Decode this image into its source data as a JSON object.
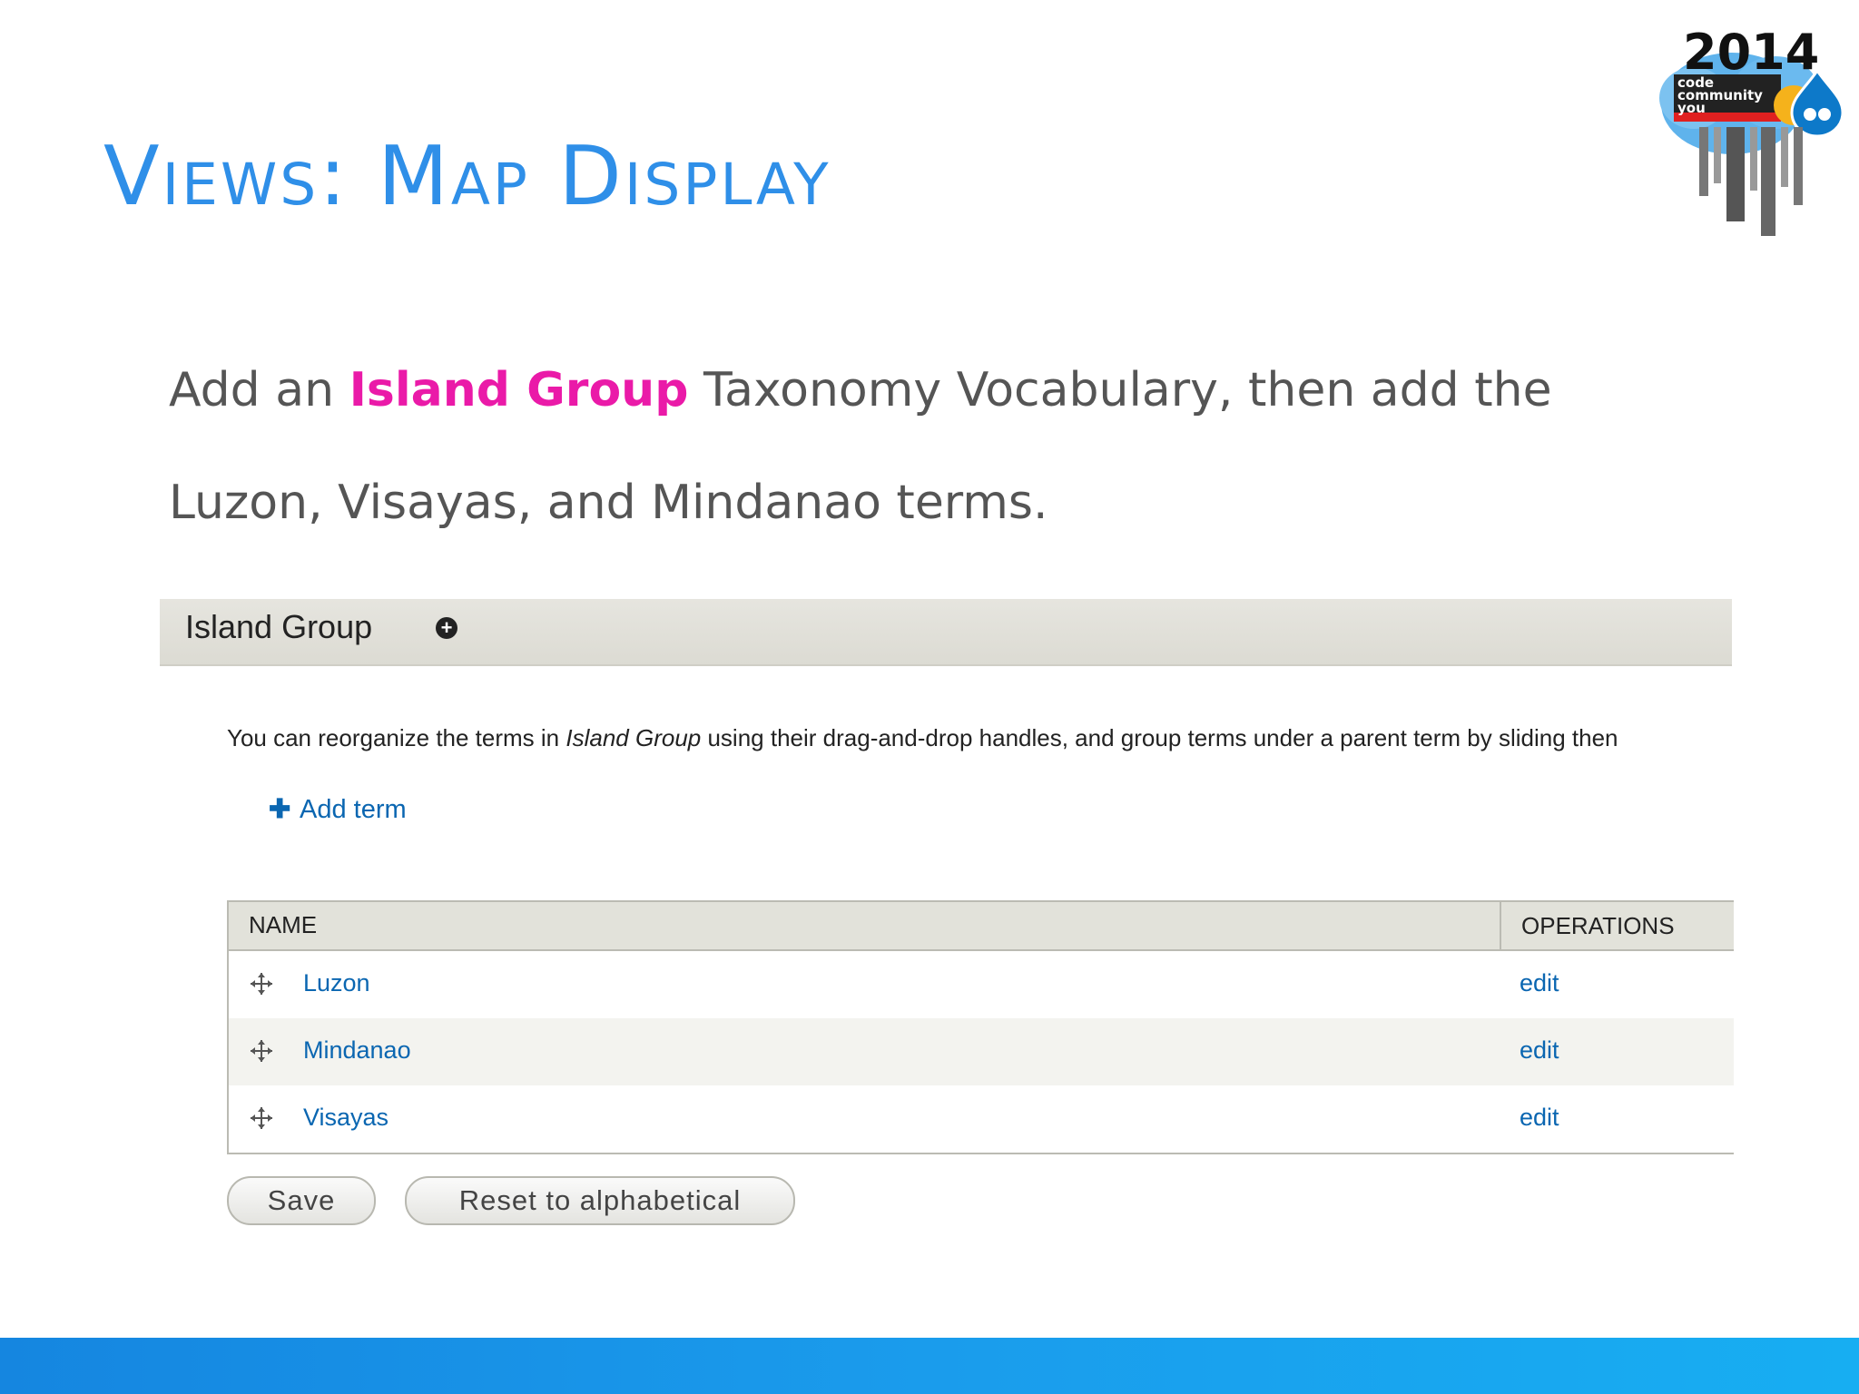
{
  "slide": {
    "title": "Views: Map Display",
    "intro_before": "Add an ",
    "intro_highlight": "Island Group",
    "intro_after": " Taxonomy Vocabulary, then add the Luzon, Visayas, and Mindanao terms.",
    "logo": {
      "year": "2014",
      "words": [
        "code",
        "community",
        "you"
      ],
      "icon": "drupal-drop-icon"
    }
  },
  "screenshot": {
    "vocabulary_title": "Island Group",
    "help_before": "You can reorganize the terms in ",
    "help_emphasis": "Island Group",
    "help_after": " using their drag-and-drop handles, and group terms under a parent term by sliding then",
    "add_term_label": "Add term",
    "table": {
      "headers": {
        "name": "NAME",
        "operations": "OPERATIONS"
      },
      "rows": [
        {
          "name": "Luzon",
          "operation": "edit"
        },
        {
          "name": "Mindanao",
          "operation": "edit"
        },
        {
          "name": "Visayas",
          "operation": "edit"
        }
      ]
    },
    "buttons": {
      "save": "Save",
      "reset": "Reset to alphabetical"
    }
  },
  "colors": {
    "title": "#2f8fe8",
    "highlight": "#ea1aa8",
    "link": "#0a66b1",
    "footer": "#1a9cec"
  }
}
